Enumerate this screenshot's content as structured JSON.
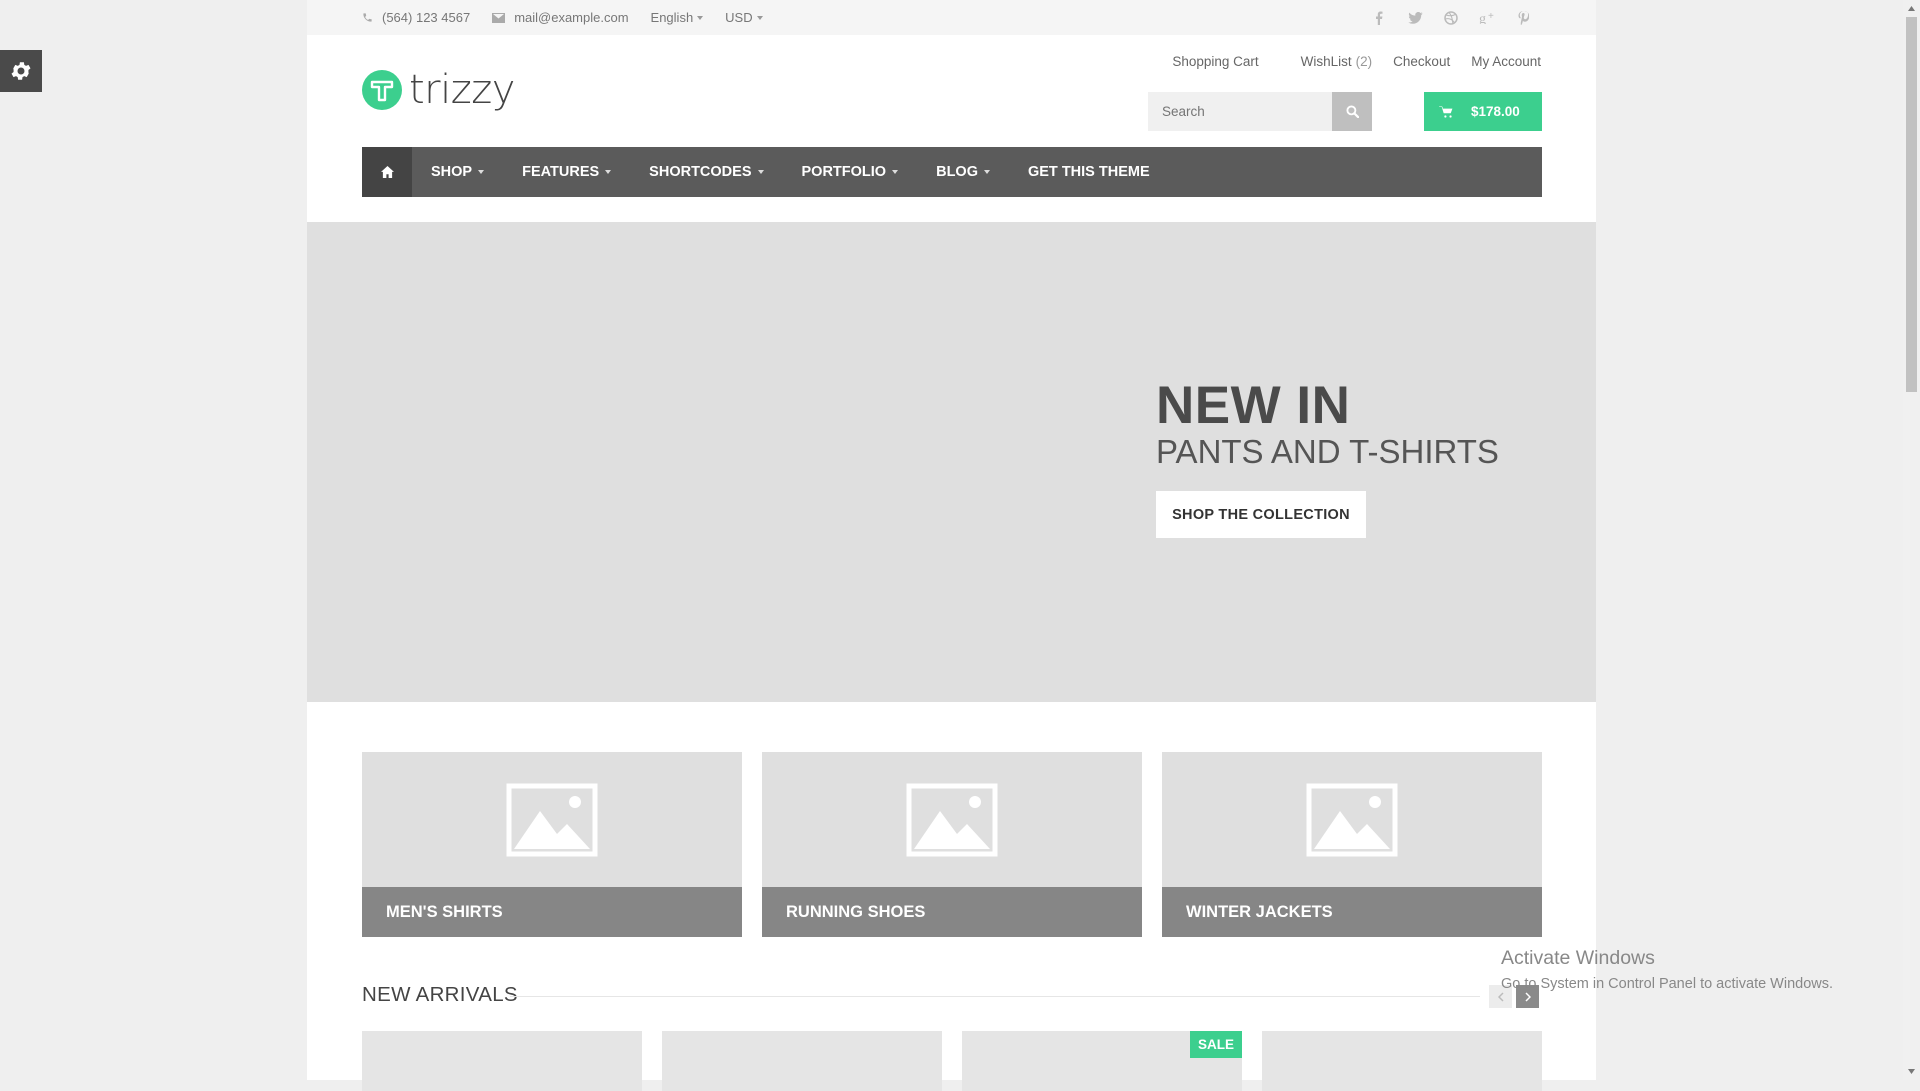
{
  "topbar": {
    "phone": "(564) 123 4567",
    "email": "mail@example.com",
    "language": "English",
    "currency": "USD",
    "social_icons": [
      "facebook-icon",
      "twitter-icon",
      "dribbble-icon",
      "google-plus-icon",
      "pinterest-icon"
    ]
  },
  "header": {
    "logo_text": "trizzy",
    "links": {
      "shopping_cart": "Shopping Cart",
      "wishlist": "WishList",
      "wishlist_count": "(2)",
      "checkout": "Checkout",
      "my_account": "My Account"
    },
    "search_placeholder": "Search",
    "cart_total": "$178.00"
  },
  "nav": {
    "items": [
      {
        "label": "SHOP",
        "dropdown": true
      },
      {
        "label": "FEATURES",
        "dropdown": true
      },
      {
        "label": "SHORTCODES",
        "dropdown": true
      },
      {
        "label": "PORTFOLIO",
        "dropdown": true
      },
      {
        "label": "BLOG",
        "dropdown": true
      },
      {
        "label": "GET THIS THEME",
        "dropdown": false
      }
    ]
  },
  "hero": {
    "title": "NEW IN",
    "subtitle": "PANTS AND T-SHIRTS",
    "button": "SHOP THE COLLECTION"
  },
  "categories": [
    {
      "label": "MEN'S SHIRTS"
    },
    {
      "label": "RUNNING SHOES"
    },
    {
      "label": "WINTER JACKETS"
    }
  ],
  "new_arrivals": {
    "title": "NEW ARRIVALS",
    "sale_badge": "SALE"
  },
  "watermark": {
    "line1": "Activate Windows",
    "line2": "Go to System in Control Panel to activate Windows."
  },
  "colors": {
    "accent": "#3ccf8e",
    "nav_bg": "#5b5b5b",
    "hero_bg": "#dfdfdf",
    "category_label_bg": "#868686"
  }
}
